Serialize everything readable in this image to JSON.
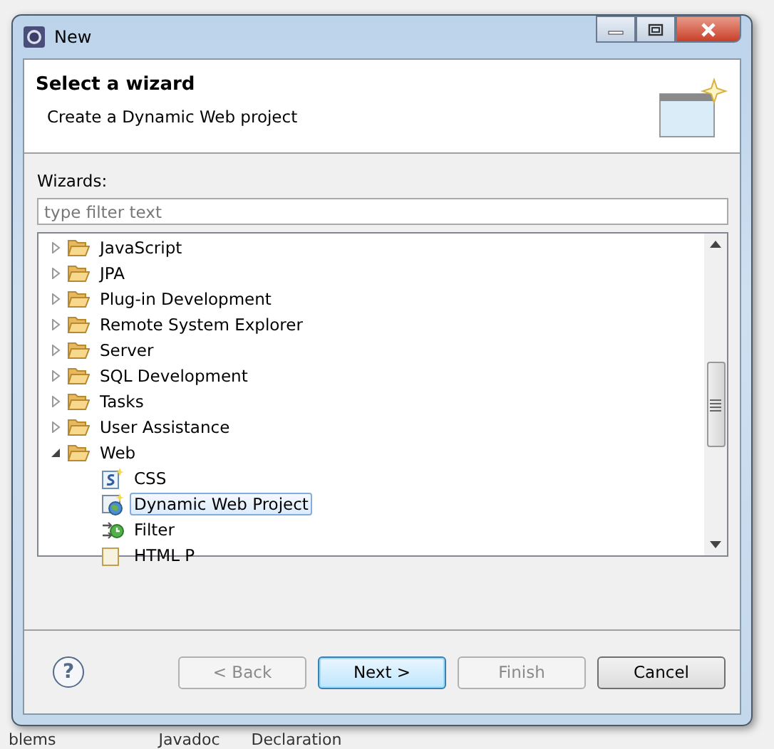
{
  "window": {
    "title": "New"
  },
  "header": {
    "title": "Select a wizard",
    "description": "Create a Dynamic Web project"
  },
  "wizards": {
    "label": "Wizards:",
    "filter": {
      "placeholder": "type filter text"
    },
    "tree": [
      {
        "label": "JavaScript",
        "kind": "folder",
        "expanded": false,
        "selected": false
      },
      {
        "label": "JPA",
        "kind": "folder",
        "expanded": false,
        "selected": false
      },
      {
        "label": "Plug-in Development",
        "kind": "folder",
        "expanded": false,
        "selected": false
      },
      {
        "label": "Remote System Explorer",
        "kind": "folder",
        "expanded": false,
        "selected": false
      },
      {
        "label": "Server",
        "kind": "folder",
        "expanded": false,
        "selected": false
      },
      {
        "label": "SQL Development",
        "kind": "folder",
        "expanded": false,
        "selected": false
      },
      {
        "label": "Tasks",
        "kind": "folder",
        "expanded": false,
        "selected": false
      },
      {
        "label": "User Assistance",
        "kind": "folder",
        "expanded": false,
        "selected": false
      },
      {
        "label": "Web",
        "kind": "folder",
        "expanded": true,
        "selected": false,
        "children": [
          {
            "label": "CSS",
            "kind": "css",
            "selected": false
          },
          {
            "label": "Dynamic Web Project",
            "kind": "project",
            "selected": true
          },
          {
            "label": "Filter",
            "kind": "filter",
            "selected": false
          },
          {
            "label": "HTML P",
            "kind": "html",
            "selected": false
          }
        ]
      }
    ]
  },
  "buttons": [
    {
      "label": "< Back",
      "disabled": true,
      "default": false
    },
    {
      "label": "Next >",
      "disabled": false,
      "default": true
    },
    {
      "label": "Finish",
      "disabled": true,
      "default": false
    },
    {
      "label": "Cancel",
      "disabled": false,
      "default": false
    }
  ],
  "help": {
    "label": "?"
  },
  "background_tabs": [
    {
      "label": "blems"
    },
    {
      "label": "Javadoc"
    },
    {
      "label": "Declaration"
    }
  ]
}
